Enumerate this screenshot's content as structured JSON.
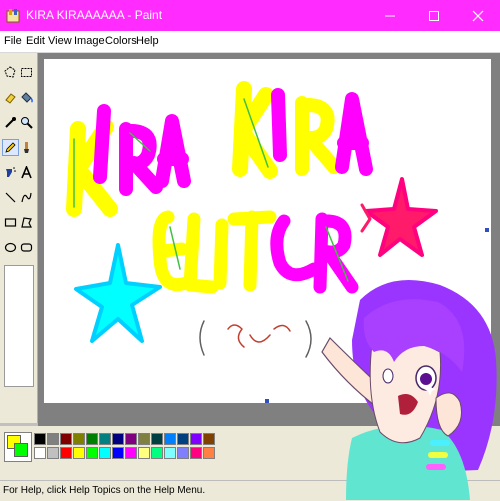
{
  "window": {
    "title": "KIRA KIRAAAAAA - Paint",
    "accent_color": "#ff2bff"
  },
  "menu": {
    "items": [
      "File",
      "Edit",
      "View",
      "Image",
      "Colors",
      "Help"
    ]
  },
  "toolbox": {
    "tools": [
      {
        "name": "free-form-select-icon"
      },
      {
        "name": "select-icon"
      },
      {
        "name": "eraser-icon"
      },
      {
        "name": "fill-icon"
      },
      {
        "name": "pick-color-icon"
      },
      {
        "name": "magnifier-icon"
      },
      {
        "name": "pencil-icon",
        "selected": true
      },
      {
        "name": "brush-icon"
      },
      {
        "name": "airbrush-icon"
      },
      {
        "name": "text-icon"
      },
      {
        "name": "line-icon"
      },
      {
        "name": "curve-icon"
      },
      {
        "name": "rectangle-icon"
      },
      {
        "name": "polygon-icon"
      },
      {
        "name": "ellipse-icon"
      },
      {
        "name": "rounded-rectangle-icon"
      }
    ]
  },
  "palette": {
    "foreground": "#ffff00",
    "background": "#00ff00",
    "colors": [
      "#000000",
      "#808080",
      "#800000",
      "#808000",
      "#008000",
      "#008080",
      "#000080",
      "#800080",
      "#808040",
      "#004040",
      "#0080ff",
      "#004080",
      "#8000ff",
      "#804000",
      "#ffffff",
      "#c0c0c0",
      "#ff0000",
      "#ffff00",
      "#00ff00",
      "#00ffff",
      "#0000ff",
      "#ff00ff",
      "#ffff80",
      "#00ff80",
      "#80ffff",
      "#8080ff",
      "#ff0080",
      "#ff8040"
    ]
  },
  "status": {
    "text": "For Help, click Help Topics on the Help Menu."
  }
}
